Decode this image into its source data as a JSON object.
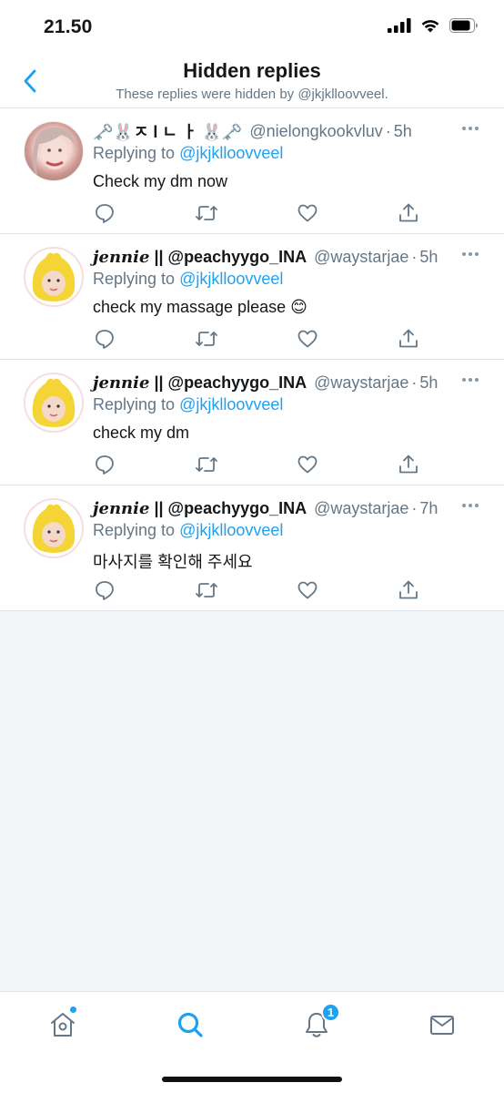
{
  "status_bar": {
    "time": "21.50"
  },
  "header": {
    "title": "Hidden replies",
    "subtitle": "These replies were hidden by @jkjklloovveel."
  },
  "replies": [
    {
      "name_plain": "🗝️🐰ㅈ l ㄴ ㅏ 🐰🗝️",
      "name_italic": "",
      "handle": "@nielongkookvluv",
      "dot": "·",
      "time": "5h",
      "replying_prefix": "Replying to",
      "replying_to": "@jkjklloovveel",
      "text": "Check my dm now",
      "avatar": "pink-portrait"
    },
    {
      "name_italic": "jennie",
      "name_plain": " || @peachyygo_INA",
      "handle": "@waystarjae",
      "dot": "·",
      "time": "5h",
      "replying_prefix": "Replying to",
      "replying_to": "@jkjklloovveel",
      "text": "check my massage please 😊",
      "avatar": "yellow-chick"
    },
    {
      "name_italic": "jennie",
      "name_plain": " || @peachyygo_INA",
      "handle": "@waystarjae",
      "dot": "·",
      "time": "5h",
      "replying_prefix": "Replying to",
      "replying_to": "@jkjklloovveel",
      "text": "check my dm",
      "avatar": "yellow-chick"
    },
    {
      "name_italic": "jennie",
      "name_plain": " || @peachyygo_INA",
      "handle": "@waystarjae",
      "dot": "·",
      "time": "7h",
      "replying_prefix": "Replying to",
      "replying_to": "@jkjklloovveel",
      "text": "마사지를 확인해 주세요",
      "avatar": "yellow-chick"
    }
  ],
  "tab_bar": {
    "notifications_badge": "1",
    "items": [
      "home-icon",
      "search-icon",
      "bell-icon",
      "mail-icon"
    ]
  },
  "colors": {
    "accent": "#1da1f2",
    "secondary_text": "#657786",
    "divider": "#dfe3e7",
    "background": "#f4f5f7"
  }
}
